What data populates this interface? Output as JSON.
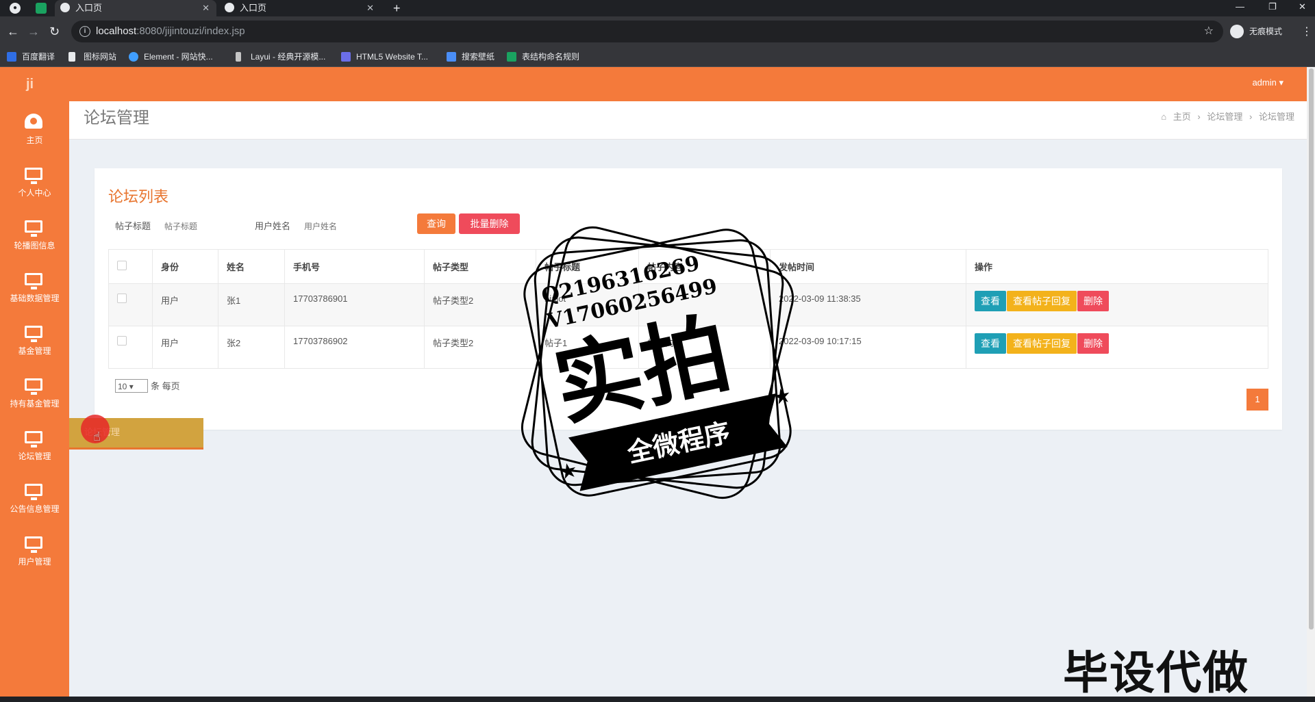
{
  "browser": {
    "tabs": [
      {
        "title": "入口页"
      },
      {
        "title": "入口页"
      }
    ],
    "url_host": "localhost",
    "url_rest": ":8080/jijintouzi/index.jsp",
    "incognito_label": "无痕模式",
    "bookmarks": [
      {
        "label": "百度翻译",
        "color": "#2f6ee5"
      },
      {
        "label": "图标网站",
        "color": "#e8eaed"
      },
      {
        "label": "Element - 网站快...",
        "color": "#409eff"
      },
      {
        "label": "Layui - 经典开源模...",
        "color": "#c5c5c5"
      },
      {
        "label": "HTML5 Website T...",
        "color": "#6b6ee8"
      },
      {
        "label": "搜索壁纸",
        "color": "#4a8ef7"
      },
      {
        "label": "表结构命名规则",
        "color": "#1aa260"
      }
    ]
  },
  "header": {
    "user": "admin ▾"
  },
  "sidebar": {
    "logo": "ji",
    "items": [
      {
        "label": "主页",
        "icon": "dashboard-icon"
      },
      {
        "label": "个人中心",
        "icon": "monitor-icon"
      },
      {
        "label": "轮播图信息",
        "icon": "monitor-icon"
      },
      {
        "label": "基础数据管理",
        "icon": "monitor-icon"
      },
      {
        "label": "基金管理",
        "icon": "monitor-icon"
      },
      {
        "label": "持有基金管理",
        "icon": "monitor-icon"
      },
      {
        "label": "论坛管理",
        "icon": "monitor-icon"
      },
      {
        "label": "公告信息管理",
        "icon": "monitor-icon"
      },
      {
        "label": "用户管理",
        "icon": "monitor-icon"
      }
    ],
    "flyout_label": "论坛管理"
  },
  "content": {
    "page_title": "论坛管理",
    "breadcrumb": [
      "主页",
      "论坛管理",
      "论坛管理"
    ],
    "card_title": "论坛列表",
    "search": {
      "field1_label": "帖子标题",
      "field1_placeholder": "帖子标题",
      "field2_label": "用户姓名",
      "field2_placeholder": "用户姓名",
      "query_button": "查询",
      "batch_delete_button": "批量删除"
    },
    "table": {
      "headers": [
        "身份",
        "姓名",
        "手机号",
        "帖子类型",
        "帖子标题",
        "帖子内容",
        "发帖时间",
        "操作"
      ],
      "rows": [
        {
          "role": "用户",
          "name": "张1",
          "phone": "17703786901",
          "type": "帖子类型2",
          "title": "biaiot",
          "body": "",
          "time": "2022-03-09 11:38:35"
        },
        {
          "role": "用户",
          "name": "张2",
          "phone": "17703786902",
          "type": "帖子类型2",
          "title": "帖子1",
          "body": "帖子内容",
          "time": "2022-03-09 10:17:15"
        }
      ],
      "actions": {
        "view": "查看",
        "view_replies": "查看帖子回复",
        "delete": "删除"
      }
    },
    "pagination": {
      "page_size": "10",
      "page_size_suffix": "条 每页",
      "current_page": "1"
    }
  },
  "watermark": {
    "qq": "Q2196316269",
    "vx": "V17060256499",
    "big": "实拍",
    "ribbon": "全微程序",
    "corner": "毕设代做"
  },
  "colors": {
    "brand_orange": "#f47a3b",
    "btn_teal": "#1f9fb5",
    "btn_yellow": "#f3b21b",
    "btn_red": "#ef4b5b"
  }
}
